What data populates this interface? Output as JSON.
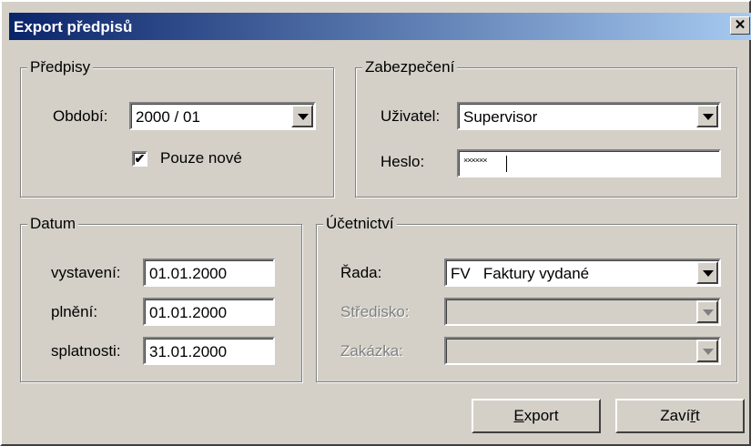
{
  "window": {
    "title": "Export předpisů",
    "close_glyph": "✕"
  },
  "predpisy": {
    "legend": "Předpisy",
    "obdobi_label": "Období:",
    "obdobi_value": "2000 / 01",
    "pouze_nove_label": "Pouze nové",
    "pouze_nove_checked": true,
    "check_glyph": "✔"
  },
  "zabezpeceni": {
    "legend": "Zabezpečení",
    "uzivatel_label": "Uživatel:",
    "uzivatel_value": "Supervisor",
    "heslo_label": "Heslo:",
    "heslo_value": "××××××"
  },
  "datum": {
    "legend": "Datum",
    "vystaveni_label": "vystavení:",
    "vystaveni_value": "01.01.2000",
    "plneni_label": "plnění:",
    "plneni_value": "01.01.2000",
    "splatnosti_label": "splatnosti:",
    "splatnosti_value": "31.01.2000"
  },
  "ucetnictvi": {
    "legend": "Účetnictví",
    "rada_label": "Řada:",
    "rada_value": "FV   Faktury vydané",
    "stredisko_label": "Středisko:",
    "stredisko_value": "",
    "zakazka_label": "Zakázka:",
    "zakazka_value": ""
  },
  "buttons": {
    "export_pre": "",
    "export_ul": "E",
    "export_post": "xport",
    "zavrit_pre": "Zaví",
    "zavrit_ul": "ř",
    "zavrit_post": "t"
  }
}
